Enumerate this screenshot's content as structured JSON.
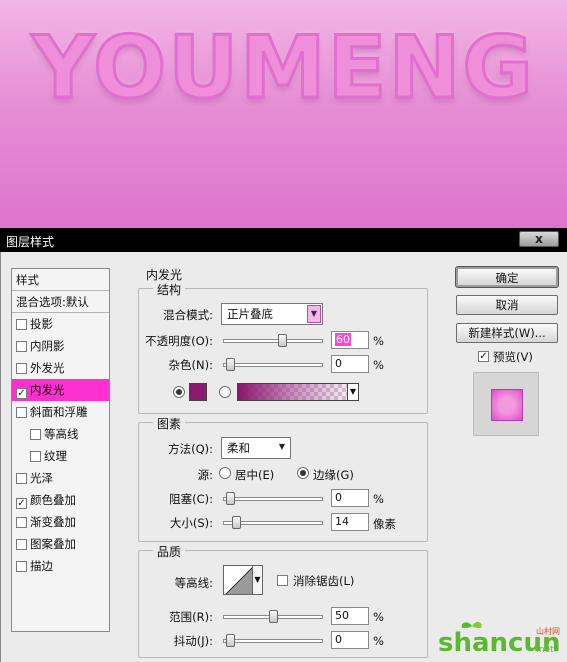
{
  "canvas": {
    "headline": "YOUMENG"
  },
  "dialog": {
    "title": "图层样式",
    "close_label": "x"
  },
  "style_list": {
    "header": "样式",
    "blend_options": "混合选项:默认",
    "items": [
      {
        "label": "投影",
        "checked": false,
        "selected": false,
        "indent": false
      },
      {
        "label": "内阴影",
        "checked": false,
        "selected": false,
        "indent": false
      },
      {
        "label": "外发光",
        "checked": false,
        "selected": false,
        "indent": false
      },
      {
        "label": "内发光",
        "checked": true,
        "selected": true,
        "indent": false
      },
      {
        "label": "斜面和浮雕",
        "checked": false,
        "selected": false,
        "indent": false
      },
      {
        "label": "等高线",
        "checked": false,
        "selected": false,
        "indent": true
      },
      {
        "label": "纹理",
        "checked": false,
        "selected": false,
        "indent": true
      },
      {
        "label": "光泽",
        "checked": false,
        "selected": false,
        "indent": false
      },
      {
        "label": "颜色叠加",
        "checked": true,
        "selected": false,
        "indent": false
      },
      {
        "label": "渐变叠加",
        "checked": false,
        "selected": false,
        "indent": false
      },
      {
        "label": "图案叠加",
        "checked": false,
        "selected": false,
        "indent": false
      },
      {
        "label": "描边",
        "checked": false,
        "selected": false,
        "indent": false
      }
    ]
  },
  "panel": {
    "title": "内发光",
    "structure": {
      "legend": "结构",
      "blend_mode_label": "混合模式:",
      "blend_mode_value": "正片叠底",
      "opacity_label": "不透明度(O):",
      "opacity_value": "60",
      "noise_label": "杂色(N):",
      "noise_value": "0",
      "percent": "%",
      "color_hex": "#8a1a6e"
    },
    "elements": {
      "legend": "图素",
      "method_label": "方法(Q):",
      "method_value": "柔和",
      "source_label": "源:",
      "source_center": "居中(E)",
      "source_edge": "边缘(G)",
      "choke_label": "阻塞(C):",
      "choke_value": "0",
      "size_label": "大小(S):",
      "size_value": "14",
      "size_unit": "像素",
      "percent": "%"
    },
    "quality": {
      "legend": "品质",
      "contour_label": "等高线:",
      "antialias_label": "消除锯齿(L)",
      "range_label": "范围(R):",
      "range_value": "50",
      "jitter_label": "抖动(J):",
      "jitter_value": "0",
      "percent": "%"
    }
  },
  "buttons": {
    "ok": "确定",
    "cancel": "取消",
    "new_style": "新建样式(W)...",
    "preview": "预览(V)"
  },
  "watermark": {
    "brand": "shancun",
    "tld": ".net",
    "sub": "山村网"
  },
  "levels": {
    "opacity": 0.6,
    "noise": 0,
    "choke": 0,
    "size": 0.07,
    "range": 0.5,
    "jitter": 0
  }
}
